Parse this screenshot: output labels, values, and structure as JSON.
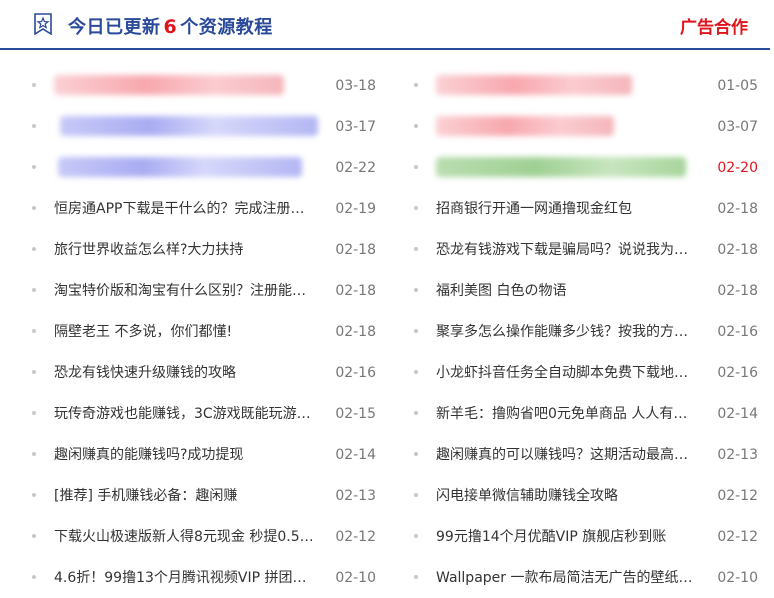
{
  "header": {
    "title_prefix": "今日已更新",
    "count": "6",
    "title_suffix": "个资源教程",
    "ad_link": "广告合作",
    "icon": "star-icon"
  },
  "colors": {
    "brand": "#2a4a9a",
    "accent": "#e0141c",
    "date": "#777777"
  },
  "left_items": [
    {
      "title": "",
      "date": "03-18"
    },
    {
      "title": "",
      "date": "03-17"
    },
    {
      "title": "",
      "date": "02-22"
    },
    {
      "title": "恒房通APP下载是干什么的？完成注册…",
      "date": "02-19"
    },
    {
      "title": "旅行世界收益怎么样?大力扶持",
      "date": "02-18"
    },
    {
      "title": "淘宝特价版和淘宝有什么区别？注册能…",
      "date": "02-18"
    },
    {
      "title": "隔壁老王 不多说，你们都懂!",
      "date": "02-18"
    },
    {
      "title": "恐龙有钱快速升级赚钱的攻略",
      "date": "02-16"
    },
    {
      "title": "玩传奇游戏也能赚钱，3C游戏既能玩游…",
      "date": "02-15"
    },
    {
      "title": "趣闲赚真的能赚钱吗?成功提现",
      "date": "02-14"
    },
    {
      "title": "[推荐] 手机赚钱必备：趣闲赚",
      "date": "02-13"
    },
    {
      "title": "下载火山极速版新人得8元现金 秒提0.5…",
      "date": "02-12"
    },
    {
      "title": "4.6折！99撸13个月腾讯视频VIP 拼团后…",
      "date": "02-10"
    }
  ],
  "right_items": [
    {
      "title": "",
      "date": "01-05"
    },
    {
      "title": "",
      "date": "03-07"
    },
    {
      "title": "",
      "date": "02-20"
    },
    {
      "title": "招商银行开通一网通撸现金红包",
      "date": "02-18"
    },
    {
      "title": "恐龙有钱游戏下载是骗局吗？说说我为…",
      "date": "02-18"
    },
    {
      "title": "福利美图 白色の物语",
      "date": "02-18"
    },
    {
      "title": "聚享多怎么操作能赚多少钱？按我的方…",
      "date": "02-16"
    },
    {
      "title": "小龙虾抖音任务全自动脚本免费下载地…",
      "date": "02-16"
    },
    {
      "title": "新羊毛：撸购省吧0元免单商品 人人有份…",
      "date": "02-14"
    },
    {
      "title": "趣闲赚真的可以赚钱吗？这期活动最高…",
      "date": "02-13"
    },
    {
      "title": "闪电接单微信辅助赚钱全攻略",
      "date": "02-12"
    },
    {
      "title": "99元撸14个月优酷VIP 旗舰店秒到账",
      "date": "02-12"
    },
    {
      "title": "Wallpaper 一款布局简洁无广告的壁纸…",
      "date": "02-10"
    }
  ]
}
